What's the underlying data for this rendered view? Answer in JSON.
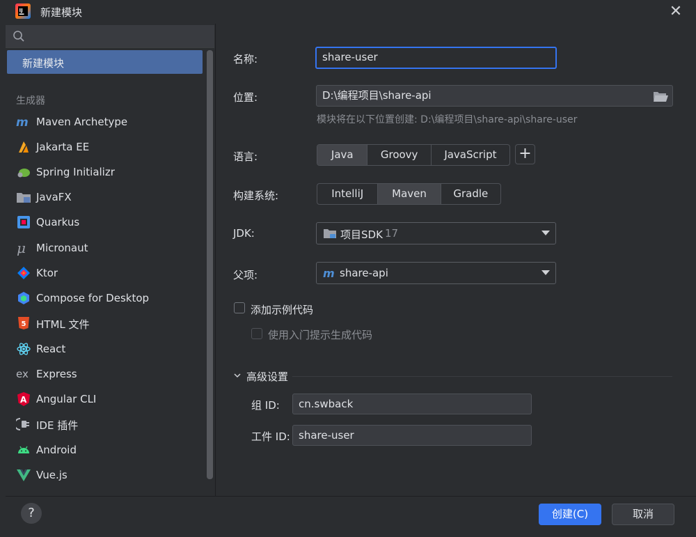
{
  "window": {
    "title": "新建模块",
    "close": "✕"
  },
  "sidebar": {
    "selected": "新建模块",
    "section_label": "生成器",
    "items": [
      {
        "label": "Maven Archetype",
        "icon": "maven-icon"
      },
      {
        "label": "Jakarta EE",
        "icon": "jakarta-ee-icon"
      },
      {
        "label": "Spring Initializr",
        "icon": "spring-icon"
      },
      {
        "label": "JavaFX",
        "icon": "javafx-icon"
      },
      {
        "label": "Quarkus",
        "icon": "quarkus-icon"
      },
      {
        "label": "Micronaut",
        "icon": "micronaut-icon"
      },
      {
        "label": "Ktor",
        "icon": "ktor-icon"
      },
      {
        "label": "Compose for Desktop",
        "icon": "compose-icon"
      },
      {
        "label": "HTML 文件",
        "icon": "html5-icon"
      },
      {
        "label": "React",
        "icon": "react-icon"
      },
      {
        "label": "Express",
        "icon": "express-icon"
      },
      {
        "label": "Angular CLI",
        "icon": "angular-icon"
      },
      {
        "label": "IDE 插件",
        "icon": "ide-plugin-icon"
      },
      {
        "label": "Android",
        "icon": "android-icon"
      },
      {
        "label": "Vue.js",
        "icon": "vue-icon"
      }
    ]
  },
  "form": {
    "name_label": "名称:",
    "name_value": "share-user",
    "location_label": "位置:",
    "location_value": "D:\\编程项目\\share-api",
    "location_hint": "模块将在以下位置创建: D:\\编程项目\\share-api\\share-user",
    "language_label": "语言:",
    "languages": [
      "Java",
      "Groovy",
      "JavaScript"
    ],
    "language_selected": "Java",
    "add_language": "+",
    "build_label": "构建系统:",
    "build_systems": [
      "IntelliJ",
      "Maven",
      "Gradle"
    ],
    "build_selected": "Maven",
    "jdk_label": "JDK:",
    "jdk_name": "项目SDK",
    "jdk_version": "17",
    "parent_label": "父项:",
    "parent_value": "share-api",
    "sample_code_label": "添加示例代码",
    "onboarding_label": "使用入门提示生成代码",
    "advanced_label": "高级设置",
    "group_id_label": "组 ID:",
    "group_id_value": "cn.swback",
    "artifact_id_label": "工件 ID:",
    "artifact_id_value": "share-user"
  },
  "footer": {
    "help": "?",
    "create": "创建(C)",
    "cancel": "取消"
  },
  "colors": {
    "accent": "#3574f0",
    "selection": "#4a6ba3",
    "background": "#2b2d30"
  }
}
